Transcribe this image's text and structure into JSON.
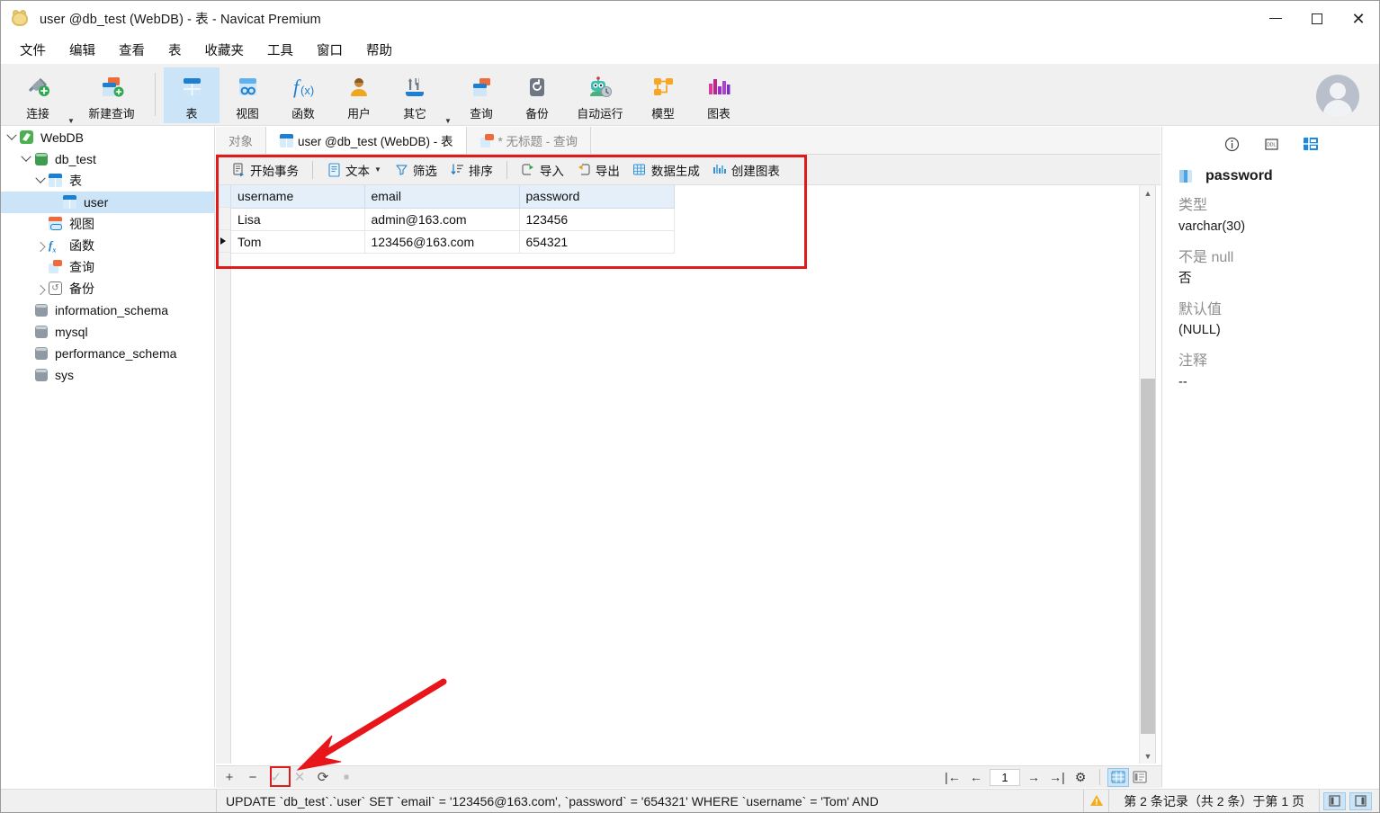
{
  "window": {
    "title": "user @db_test (WebDB) - 表 - Navicat Premium",
    "app_icon": "navicat-cat-icon",
    "minimize_label": "最小化",
    "maximize_label": "最大化",
    "close_label": "关闭"
  },
  "menu": {
    "items": [
      {
        "label": "文件"
      },
      {
        "label": "编辑"
      },
      {
        "label": "查看"
      },
      {
        "label": "表"
      },
      {
        "label": "收藏夹"
      },
      {
        "label": "工具"
      },
      {
        "label": "窗口"
      },
      {
        "label": "帮助"
      }
    ]
  },
  "ribbon": {
    "items": [
      {
        "label": "连接",
        "icon": "connection-icon",
        "has_caret": true,
        "active": false
      },
      {
        "label": "新建查询",
        "icon": "new-query-icon",
        "has_caret": false,
        "active": false
      },
      {
        "label": "表",
        "icon": "table-icon",
        "has_caret": false,
        "active": true
      },
      {
        "label": "视图",
        "icon": "view-icon",
        "has_caret": false,
        "active": false
      },
      {
        "label": "函数",
        "icon": "function-icon",
        "has_caret": false,
        "active": false
      },
      {
        "label": "用户",
        "icon": "user-icon",
        "has_caret": false,
        "active": false
      },
      {
        "label": "其它",
        "icon": "others-icon",
        "has_caret": true,
        "active": false
      },
      {
        "label": "查询",
        "icon": "query-icon",
        "has_caret": false,
        "active": false
      },
      {
        "label": "备份",
        "icon": "backup-icon",
        "has_caret": false,
        "active": false
      },
      {
        "label": "自动运行",
        "icon": "automation-icon",
        "has_caret": false,
        "active": false
      },
      {
        "label": "模型",
        "icon": "model-icon",
        "has_caret": false,
        "active": false
      },
      {
        "label": "图表",
        "icon": "chart-icon",
        "has_caret": false,
        "active": false
      }
    ],
    "avatar": "user-avatar"
  },
  "sidebar": {
    "items": [
      {
        "label": "WebDB",
        "icon": "connection-icon",
        "depth": 0,
        "twisty": "open",
        "selected": false
      },
      {
        "label": "db_test",
        "icon": "database-icon",
        "depth": 1,
        "twisty": "open",
        "selected": false
      },
      {
        "label": "表",
        "icon": "table-icon",
        "depth": 2,
        "twisty": "open",
        "selected": false
      },
      {
        "label": "user",
        "icon": "table-icon",
        "depth": 3,
        "twisty": "none",
        "selected": true
      },
      {
        "label": "视图",
        "icon": "view-icon",
        "depth": 2,
        "twisty": "none",
        "selected": false
      },
      {
        "label": "函数",
        "icon": "function-icon",
        "depth": 2,
        "twisty": "closed",
        "selected": false
      },
      {
        "label": "查询",
        "icon": "query-icon",
        "depth": 2,
        "twisty": "none",
        "selected": false
      },
      {
        "label": "备份",
        "icon": "backup-icon",
        "depth": 2,
        "twisty": "closed",
        "selected": false
      },
      {
        "label": "information_schema",
        "icon": "database-grey-icon",
        "depth": 1,
        "twisty": "none",
        "selected": false
      },
      {
        "label": "mysql",
        "icon": "database-grey-icon",
        "depth": 1,
        "twisty": "none",
        "selected": false
      },
      {
        "label": "performance_schema",
        "icon": "database-grey-icon",
        "depth": 1,
        "twisty": "none",
        "selected": false
      },
      {
        "label": "sys",
        "icon": "database-grey-icon",
        "depth": 1,
        "twisty": "none",
        "selected": false
      }
    ]
  },
  "tabs": [
    {
      "label": "对象",
      "icon": "none",
      "active": false
    },
    {
      "label": "user @db_test (WebDB) - 表",
      "icon": "table-icon",
      "active": true
    },
    {
      "label": "* 无标题 - 查询",
      "icon": "query-icon",
      "active": false
    }
  ],
  "grid_toolbar": {
    "items": [
      {
        "label": "开始事务",
        "icon": "begin-transaction-icon",
        "caret": false
      },
      {
        "label": "文本",
        "icon": "text-icon",
        "caret": true
      },
      {
        "label": "筛选",
        "icon": "filter-icon",
        "caret": false
      },
      {
        "label": "排序",
        "icon": "sort-icon",
        "caret": false
      },
      {
        "label": "导入",
        "icon": "import-icon",
        "caret": false
      },
      {
        "label": "导出",
        "icon": "export-icon",
        "caret": false
      },
      {
        "label": "数据生成",
        "icon": "data-generation-icon",
        "caret": false
      },
      {
        "label": "创建图表",
        "icon": "create-chart-icon",
        "caret": false
      }
    ]
  },
  "grid": {
    "columns": [
      "username",
      "email",
      "password"
    ],
    "selected_column": "password",
    "rows": [
      {
        "cells": [
          "Lisa",
          "admin@163.com",
          "123456"
        ],
        "current": false
      },
      {
        "cells": [
          "Tom",
          "123456@163.com",
          "654321"
        ],
        "current": true
      }
    ]
  },
  "info_panel": {
    "tabs": [
      {
        "name": "info-tab",
        "icon": "info-circle-icon",
        "active": false
      },
      {
        "name": "ddl-tab",
        "icon": "ddl-icon",
        "active": false
      },
      {
        "name": "field-tab",
        "icon": "field-grid-icon",
        "active": true
      }
    ],
    "field_icon": "column-icon",
    "field_name": "password",
    "fields": [
      {
        "label": "类型",
        "value": "varchar(30)"
      },
      {
        "label": "不是 null",
        "value": "否"
      },
      {
        "label": "默认值",
        "value": "(NULL)"
      },
      {
        "label": "注释",
        "value": "--"
      }
    ]
  },
  "nav_bar": {
    "left_buttons": [
      {
        "name": "add-record-button",
        "glyph": "+",
        "dim": false,
        "highlighted": false
      },
      {
        "name": "delete-record-button",
        "glyph": "−",
        "dim": false,
        "highlighted": false
      },
      {
        "name": "apply-change-button",
        "glyph": "✓",
        "dim": true,
        "highlighted": true
      },
      {
        "name": "cancel-change-button",
        "glyph": "✕",
        "dim": true,
        "highlighted": false
      },
      {
        "name": "refresh-button",
        "glyph": "⟳",
        "dim": false,
        "highlighted": false
      },
      {
        "name": "stop-button",
        "glyph": "■",
        "dim": true,
        "highlighted": false
      }
    ],
    "page_value": "1",
    "right_buttons": [
      {
        "name": "first-page-button",
        "glyph": "|←"
      },
      {
        "name": "prev-page-button",
        "glyph": "←"
      },
      {
        "name": "next-page-button",
        "glyph": "→"
      },
      {
        "name": "last-page-button",
        "glyph": "→|"
      },
      {
        "name": "grid-options-button",
        "glyph": "⚙"
      }
    ],
    "view_buttons": [
      {
        "name": "grid-view-button",
        "icon": "grid-view-icon",
        "active": true
      },
      {
        "name": "form-view-button",
        "icon": "form-view-icon",
        "active": false
      }
    ]
  },
  "status_bar": {
    "sql": "UPDATE `db_test`.`user` SET `email` = '123456@163.com', `password` = '654321' WHERE `username` = 'Tom' AND",
    "warning_icon": "warning-triangle-icon",
    "record_info": "第 2 条记录（共 2 条）于第 1 页",
    "right_buttons": [
      {
        "name": "toggle-left-pane-button",
        "icon": "left-pane-icon"
      },
      {
        "name": "toggle-right-pane-button",
        "icon": "right-pane-icon"
      }
    ]
  },
  "annotations": {
    "highlight_box_color": "#e01b1b",
    "arrow_color": "#e8151a"
  }
}
